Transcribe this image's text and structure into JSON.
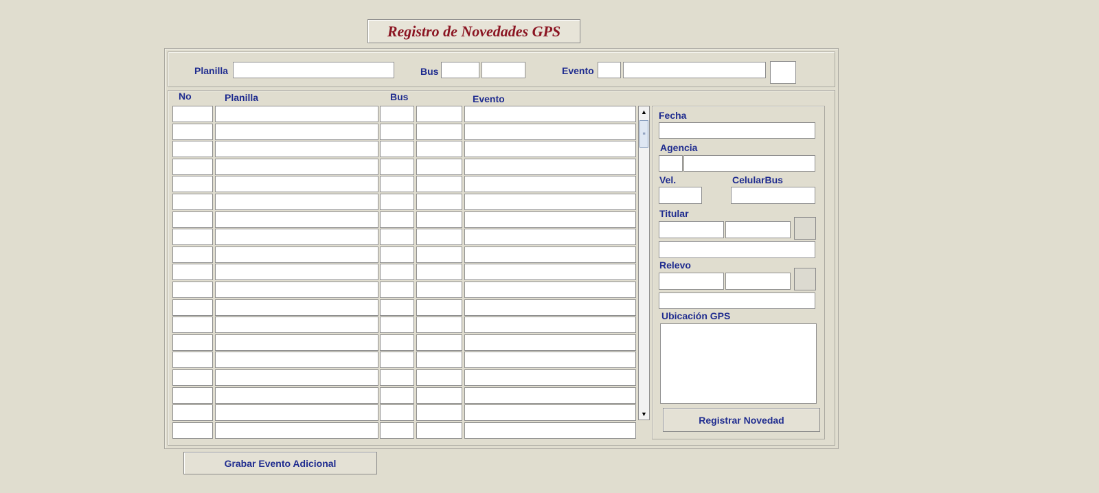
{
  "title": "Registro de Novedades GPS",
  "header": {
    "planilla_label": "Planilla",
    "planilla_value": "",
    "bus_label": "Bus",
    "bus_value_1": "",
    "bus_value_2": "",
    "evento_label": "Evento",
    "evento_code": "",
    "evento_desc": ""
  },
  "table": {
    "columns": [
      "No",
      "Planilla",
      "Bus",
      "Evento"
    ],
    "rows": [
      [
        "",
        "",
        "",
        "",
        ""
      ],
      [
        "",
        "",
        "",
        "",
        ""
      ],
      [
        "",
        "",
        "",
        "",
        ""
      ],
      [
        "",
        "",
        "",
        "",
        ""
      ],
      [
        "",
        "",
        "",
        "",
        ""
      ],
      [
        "",
        "",
        "",
        "",
        ""
      ],
      [
        "",
        "",
        "",
        "",
        ""
      ],
      [
        "",
        "",
        "",
        "",
        ""
      ],
      [
        "",
        "",
        "",
        "",
        ""
      ],
      [
        "",
        "",
        "",
        "",
        ""
      ],
      [
        "",
        "",
        "",
        "",
        ""
      ],
      [
        "",
        "",
        "",
        "",
        ""
      ],
      [
        "",
        "",
        "",
        "",
        ""
      ],
      [
        "",
        "",
        "",
        "",
        ""
      ],
      [
        "",
        "",
        "",
        "",
        ""
      ],
      [
        "",
        "",
        "",
        "",
        ""
      ],
      [
        "",
        "",
        "",
        "",
        ""
      ],
      [
        "",
        "",
        "",
        "",
        ""
      ],
      [
        "",
        "",
        "",
        "",
        ""
      ]
    ]
  },
  "detail": {
    "fecha_label": "Fecha",
    "agencia_label": "Agencia",
    "vel_label": "Vel.",
    "celular_label": "CelularBus",
    "titular_label": "Titular",
    "relevo_label": "Relevo",
    "ubicacion_label": "Ubicación GPS",
    "register_button": "Registrar Novedad"
  },
  "footer": {
    "save_button": "Grabar Evento Adicional"
  },
  "colors": {
    "background": "#e0ddcf",
    "title": "#8b1522",
    "label": "#1f2c8f"
  }
}
